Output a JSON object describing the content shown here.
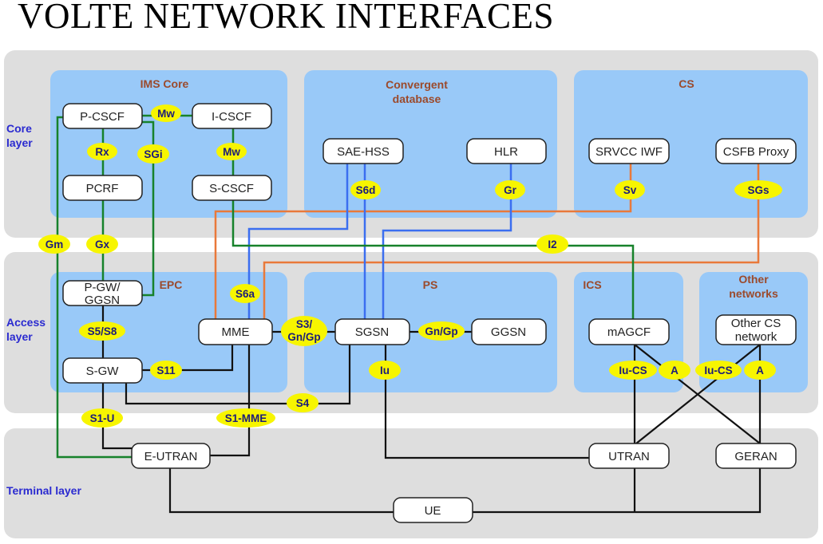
{
  "title": "VOLTE NETWORK INTERFACES",
  "layers": {
    "core": [
      "Core",
      "layer"
    ],
    "access": [
      "Access",
      "layer"
    ],
    "terminal": "Terminal layer"
  },
  "groups": {
    "ims": "IMS Core",
    "convergent": [
      "Convergent",
      "database"
    ],
    "cs": "CS",
    "epc": "EPC",
    "ps": "PS",
    "ics": "ICS",
    "other": [
      "Other",
      "networks"
    ]
  },
  "nodes": {
    "pcscf": "P-CSCF",
    "icscf": "I-CSCF",
    "pcrf": "PCRF",
    "scscf": "S-CSCF",
    "saehss": "SAE-HSS",
    "hlr": "HLR",
    "srvcc": "SRVCC IWF",
    "csfb": "CSFB Proxy",
    "pgw": [
      "P-GW/",
      "GGSN"
    ],
    "mme": "MME",
    "sgw": "S-GW",
    "sgsn": "SGSN",
    "ggsn": "GGSN",
    "magcf": "mAGCF",
    "othercs": [
      "Other CS",
      "network"
    ],
    "eutran": "E-UTRAN",
    "utran": "UTRAN",
    "geran": "GERAN",
    "ue": "UE"
  },
  "interfaces": {
    "mw1": "Mw",
    "rx": "Rx",
    "sgi": "SGi",
    "mw2": "Mw",
    "gm": "Gm",
    "gx": "Gx",
    "s6a": "S6a",
    "s5s8": "S5/S8",
    "s3": [
      "S3/",
      "Gn/Gp"
    ],
    "s11": "S11",
    "s4": "S4",
    "s1u": "S1-U",
    "s1mme": "S1-MME",
    "s6d": "S6d",
    "gr": "Gr",
    "sv": "Sv",
    "sgs": "SGs",
    "i2": "I2",
    "gngp": "Gn/Gp",
    "iu": "Iu",
    "iucs1": "Iu-CS",
    "a1": "A",
    "iucs2": "Iu-CS",
    "a2": "A"
  },
  "colors": {
    "sip_ims": "#17822b",
    "cs_fallback": "#e9793a",
    "subscriber_db": "#3b6ef0",
    "bearer": "#111111",
    "interface_label": "#f7f500"
  }
}
